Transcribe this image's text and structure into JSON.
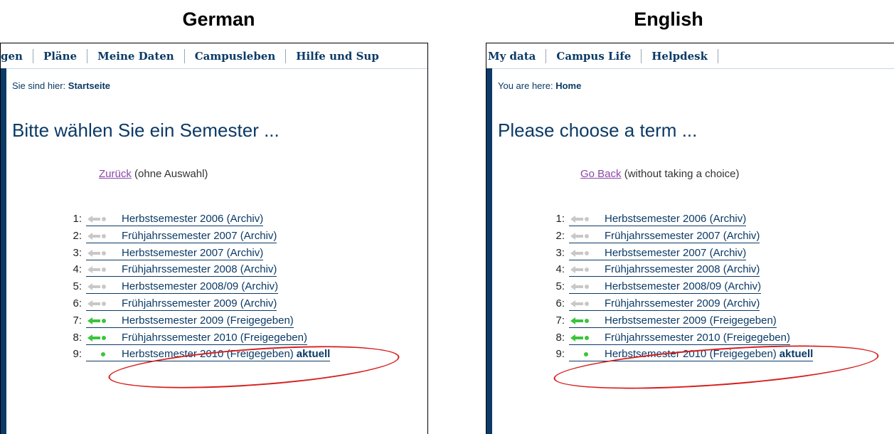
{
  "captions": {
    "german": "German",
    "english": "English"
  },
  "german": {
    "nav": [
      "gen",
      "Pläne",
      "Meine Daten",
      "Campusleben",
      "Hilfe und Sup"
    ],
    "breadcrumb_prefix": "Sie sind hier:",
    "breadcrumb_current": "Startseite",
    "title": "Bitte wählen Sie ein Semester ...",
    "back_link": "Zurück",
    "back_note": "(ohne Auswahl)",
    "current_marker": "aktuell",
    "semesters": [
      {
        "num": "1:",
        "label": "Herbstsemester 2006 (Archiv)",
        "arrow": "gray"
      },
      {
        "num": "2:",
        "label": "Frühjahrssemester 2007 (Archiv)",
        "arrow": "gray"
      },
      {
        "num": "3:",
        "label": "Herbstsemester 2007 (Archiv)",
        "arrow": "gray"
      },
      {
        "num": "4:",
        "label": "Frühjahrssemester 2008 (Archiv)",
        "arrow": "gray"
      },
      {
        "num": "5:",
        "label": "Herbstsemester 2008/09 (Archiv)",
        "arrow": "gray"
      },
      {
        "num": "6:",
        "label": "Frühjahrssemester 2009 (Archiv)",
        "arrow": "gray"
      },
      {
        "num": "7:",
        "label": "Herbstsemester 2009 (Freigegeben)",
        "arrow": "green"
      },
      {
        "num": "8:",
        "label": "Frühjahrssemester 2010 (Freigegeben)",
        "arrow": "green"
      },
      {
        "num": "9:",
        "label": "Herbstsemester 2010 (Freigegeben)",
        "arrow": "dot",
        "current": true
      }
    ]
  },
  "english": {
    "nav": [
      "My data",
      "Campus Life",
      "Helpdesk"
    ],
    "breadcrumb_prefix": "You are here:",
    "breadcrumb_current": "Home",
    "title": "Please choose a term ...",
    "back_link": "Go Back",
    "back_note": "(without taking a choice)",
    "current_marker": "aktuell",
    "semesters": [
      {
        "num": "1:",
        "label": "Herbstsemester 2006 (Archiv)",
        "arrow": "gray"
      },
      {
        "num": "2:",
        "label": "Frühjahrssemester 2007 (Archiv)",
        "arrow": "gray"
      },
      {
        "num": "3:",
        "label": "Herbstsemester 2007 (Archiv)",
        "arrow": "gray"
      },
      {
        "num": "4:",
        "label": "Frühjahrssemester 2008 (Archiv)",
        "arrow": "gray"
      },
      {
        "num": "5:",
        "label": "Herbstsemester 2008/09 (Archiv)",
        "arrow": "gray"
      },
      {
        "num": "6:",
        "label": "Frühjahrssemester 2009 (Archiv)",
        "arrow": "gray"
      },
      {
        "num": "7:",
        "label": "Herbstsemester 2009 (Freigegeben)",
        "arrow": "green"
      },
      {
        "num": "8:",
        "label": "Frühjahrssemester 2010 (Freigegeben)",
        "arrow": "green"
      },
      {
        "num": "9:",
        "label": "Herbstsemester 2010 (Freigegeben)",
        "arrow": "dot",
        "current": true
      }
    ]
  },
  "colors": {
    "brand_dark_blue": "#0b3a66",
    "link_visited": "#8b48a8",
    "arrow_gray": "#c8c8c8",
    "arrow_green": "#3cc43c",
    "highlight_red": "#d71d1d"
  }
}
